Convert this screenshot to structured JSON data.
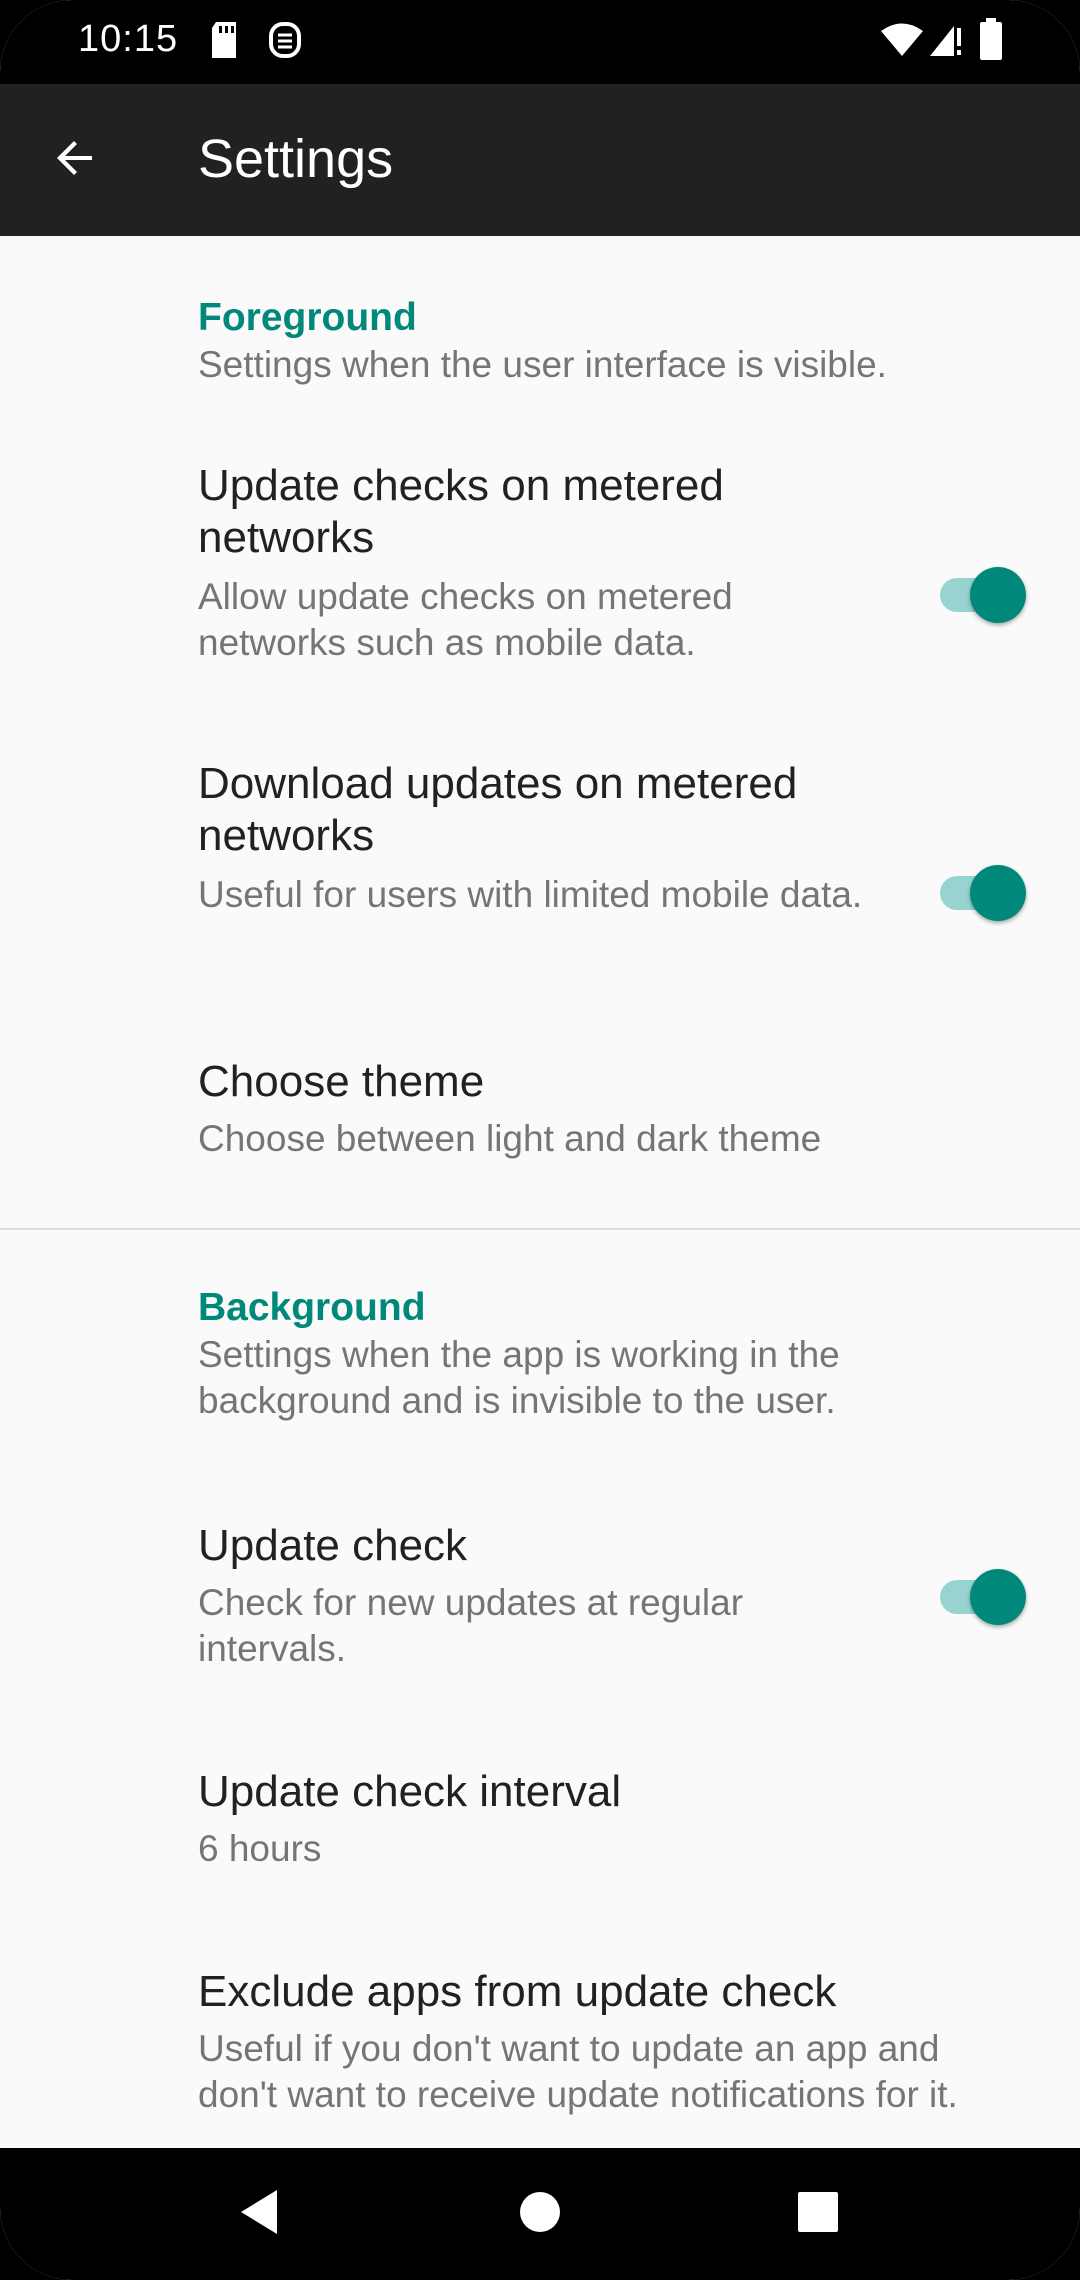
{
  "status_bar": {
    "time": "10:15",
    "icons": [
      "sd-card-icon",
      "app-notification-icon",
      "wifi-icon",
      "signal-icon",
      "battery-icon"
    ]
  },
  "app_bar": {
    "title": "Settings",
    "back_icon": "back-arrow-icon"
  },
  "foreground": {
    "title": "Foreground",
    "summary": "Settings when the user interface is visible.",
    "update_checks_metered": {
      "title": "Update checks on metered networks",
      "summary": "Allow update checks on metered networks such as mobile data.",
      "enabled": true
    },
    "download_updates_metered": {
      "title": "Download updates on metered networks",
      "summary": "Useful for users with limited mobile data.",
      "enabled": true
    },
    "choose_theme": {
      "title": "Choose theme",
      "summary": "Choose between light and dark theme"
    }
  },
  "background": {
    "title": "Background",
    "summary": "Settings when the app is working in the background and is invisible to the user.",
    "update_check": {
      "title": "Update check",
      "summary": "Check for new updates at regular intervals.",
      "enabled": true
    },
    "update_check_interval": {
      "title": "Update check interval",
      "summary": "6 hours"
    },
    "exclude_apps": {
      "title": "Exclude apps from update check",
      "summary": "Useful if you don't want to update an app and don't want to receive update notifications for it."
    }
  },
  "nav_bar": {
    "icons": [
      "nav-back-icon",
      "nav-home-icon",
      "nav-recents-icon"
    ]
  },
  "colors": {
    "accent": "#00897b",
    "app_bar": "#212121",
    "background": "#fafafa"
  }
}
